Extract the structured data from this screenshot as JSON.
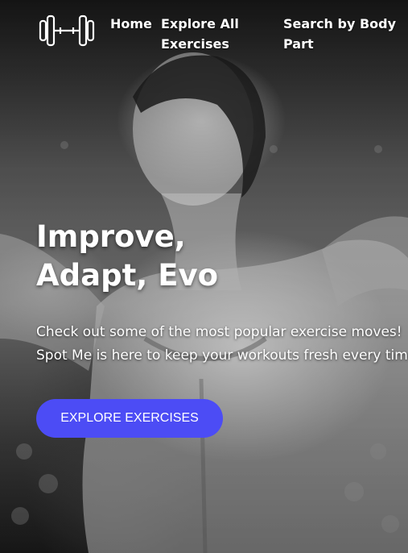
{
  "nav": {
    "logo_icon": "dumbbell-icon",
    "links": [
      {
        "label": "Home"
      },
      {
        "label": "Explore All Exercises"
      },
      {
        "label": "Search by Body Part"
      }
    ]
  },
  "hero": {
    "headline": "Improve, Adapt, Evo",
    "subtitle_line1": "Check out some of the most popular exercise moves!",
    "subtitle_line2": "Spot Me is here to keep your workouts fresh every time",
    "cta_label": "EXPLORE EXERCISES",
    "cta_color": "#4c4cf5"
  }
}
